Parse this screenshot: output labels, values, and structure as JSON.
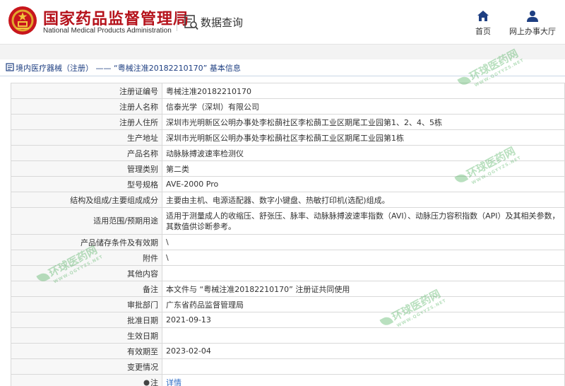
{
  "header": {
    "brand_cn": "国家药品监督管理局",
    "brand_en": "National Medical Products Administration",
    "query_label": "数据查询",
    "nav": [
      {
        "label": "首页",
        "icon": "home-icon"
      },
      {
        "label": "网上办事大厅",
        "icon": "person-icon"
      }
    ]
  },
  "breadcrumb": {
    "text": "境内医疗器械（注册） —— “粤械注准20182210170” 基本信息"
  },
  "fields": [
    {
      "label": "注册证编号",
      "value": "粤械注准20182210170"
    },
    {
      "label": "注册人名称",
      "value": "信泰光学（深圳）有限公司"
    },
    {
      "label": "注册人住所",
      "value": "深圳市光明新区公明办事处李松蓢社区李松蓢工业区期尾工业园第1、2、4、5栋"
    },
    {
      "label": "生产地址",
      "value": "深圳市光明新区公明办事处李松蓢社区李松蓢工业区期尾工业园第1栋"
    },
    {
      "label": "产品名称",
      "value": "动脉脉搏波速率检测仪"
    },
    {
      "label": "管理类别",
      "value": "第二类"
    },
    {
      "label": "型号规格",
      "value": "AVE-2000 Pro"
    },
    {
      "label": "结构及组成/主要组成成分",
      "value": "主要由主机、电源适配器、数字小键盘、热敏打印机(选配)组成。"
    },
    {
      "label": "适用范围/预期用途",
      "value": "适用于测量成人的收缩压、舒张压、脉率、动脉脉搏波速率指数（AVI）、动脉压力容积指数（API）及其相关参数，其数值供诊断参考。"
    },
    {
      "label": "产品储存条件及有效期",
      "value": "\\"
    },
    {
      "label": "附件",
      "value": "\\"
    },
    {
      "label": "其他内容",
      "value": ""
    },
    {
      "label": "备注",
      "value": "本文件与 “粤械注准20182210170” 注册证共同使用"
    },
    {
      "label": "审批部门",
      "value": "广东省药品监督管理局"
    },
    {
      "label": "批准日期",
      "value": "2021-09-13"
    },
    {
      "label": "生效日期",
      "value": ""
    },
    {
      "label": "有效期至",
      "value": "2023-02-04"
    },
    {
      "label": "变更情况",
      "value": ""
    }
  ],
  "note": {
    "label": "注",
    "link": "详情"
  },
  "watermark": {
    "main": "环球医药网",
    "sub": "WWW.QGYYZS.NET"
  },
  "colors": {
    "brand_red": "#b5121b",
    "nav_blue": "#1e3f82",
    "link_blue": "#2b6ac4",
    "watermark_green": "#3aa74a"
  }
}
